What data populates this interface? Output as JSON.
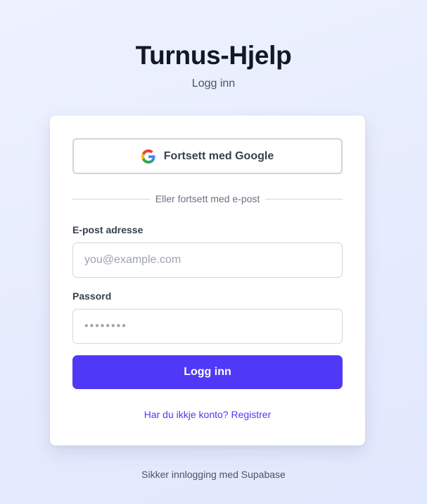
{
  "header": {
    "title": "Turnus-Hjelp",
    "subtitle": "Logg inn"
  },
  "card": {
    "google_button": {
      "label": "Fortsett med Google",
      "icon": "google-icon"
    },
    "divider_text": "Eller fortsett med e-post",
    "email": {
      "label": "E-post adresse",
      "placeholder": "you@example.com",
      "value": ""
    },
    "password": {
      "label": "Passord",
      "placeholder": "••••••••",
      "value": ""
    },
    "submit_label": "Logg inn",
    "register_link": "Har du ikkje konto? Registrer"
  },
  "footer": {
    "text": "Sikker innlogging med Supabase"
  },
  "colors": {
    "accent": "#4f39f6",
    "title": "#111827",
    "muted": "#4b5563",
    "card_bg": "#ffffff",
    "page_bg": "#e6ebfd"
  }
}
